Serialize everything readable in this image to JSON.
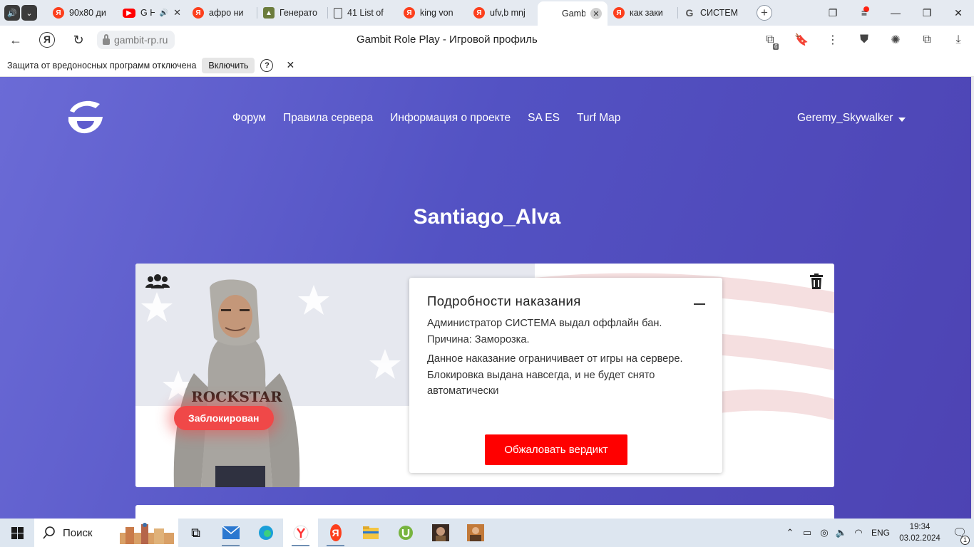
{
  "browser": {
    "tabs": [
      {
        "title": "90x80 ди",
        "icon": "yandex-icon"
      },
      {
        "title": "G H",
        "icon": "youtube-icon"
      },
      {
        "title": "афро ни",
        "icon": "yandex-icon"
      },
      {
        "title": "Генерато",
        "icon": "generator-icon"
      },
      {
        "title": "41 List of",
        "icon": "document-icon"
      },
      {
        "title": "king von",
        "icon": "yandex-icon"
      },
      {
        "title": "ufv,b mnj",
        "icon": "yandex-icon"
      },
      {
        "title": "Gamb",
        "icon": "gambit-icon"
      },
      {
        "title": "как заки",
        "icon": "yandex-icon"
      },
      {
        "title": "СИСТЕМ",
        "icon": "gambit-icon"
      }
    ],
    "url": "gambit-rp.ru",
    "page_title": "Gambit Role Play - Игровой профиль",
    "extension_badge": "6",
    "protection": {
      "message": "Защита от вредоносных программ отключена",
      "enable_label": "Включить",
      "help_label": "?"
    }
  },
  "site": {
    "nav": [
      "Форум",
      "Правила сервера",
      "Информация о проекте",
      "SA ES",
      "Turf Map"
    ],
    "user": "Geremy_Skywalker",
    "player_name": "Santiago_Alva",
    "status_badge": "Заблокирован",
    "punishment": {
      "title": "Подробности наказания",
      "line1": "Администратор СИСТЕМА выдал оффлайн бан.",
      "line2": "Причина: Заморозка.",
      "description": "Данное наказание ограничивает от игры на сервере. Блокировка выдана навсегда, и не будет снято автоматически",
      "appeal_label": "Обжаловать вердикт"
    }
  },
  "taskbar": {
    "search_label": "Поиск",
    "lang": "ENG",
    "time": "19:34",
    "date": "03.02.2024",
    "notifications": "1"
  },
  "colors": {
    "page_gradient_start": "#6b6bd6",
    "page_gradient_end": "#4d43b3",
    "appeal_button": "#ff0000",
    "ban_badge": "#f04848"
  }
}
